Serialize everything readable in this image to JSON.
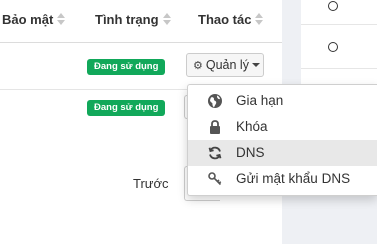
{
  "table": {
    "columns": {
      "bao_mat": "Bảo mật",
      "tinh_trang": "Tình trạng",
      "thao_tac": "Thao tác"
    },
    "rows": [
      {
        "status": "Đang sử dụng",
        "action_label": "Quản lý"
      },
      {
        "status": "Đang sử dụng"
      }
    ]
  },
  "menu": {
    "items": [
      {
        "label": "Gia hạn",
        "icon": "globe-icon"
      },
      {
        "label": "Khóa",
        "icon": "lock-icon"
      },
      {
        "label": "DNS",
        "icon": "refresh-icon",
        "active": true
      },
      {
        "label": "Gửi mật khẩu DNS",
        "icon": "key-icon"
      }
    ]
  },
  "pagination": {
    "prev_label": "Trước"
  },
  "colors": {
    "badge_green": "#11a85a",
    "menu_active": "#e8e8e8",
    "side_panel": "#eef0f4"
  }
}
